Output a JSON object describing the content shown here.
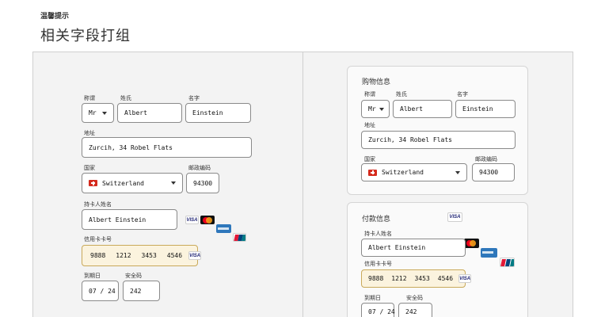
{
  "header": {
    "tip": "温馨提示",
    "title": "相关字段打组"
  },
  "left": {
    "labels": {
      "salutation": "称谓",
      "last_name": "姓氏",
      "first_name": "名字",
      "address": "地址",
      "country": "国家",
      "postcode": "邮政编码",
      "cardholder": "持卡人姓名",
      "card_number": "信用卡卡号",
      "expiry": "到期日",
      "cvc": "安全码"
    },
    "values": {
      "salutation": "Mr",
      "last_name": "Albert",
      "first_name": "Einstein",
      "address": "Zurcih, 34 Robel Flats",
      "country": "Switzerland",
      "postcode": "94300",
      "cardholder": "Albert Einstein",
      "card_groups": [
        "9888",
        "1212",
        "3453",
        "4546"
      ],
      "expiry": "07 / 24",
      "cvc": "242"
    }
  },
  "right": {
    "shipping": {
      "title": "购物信息",
      "labels": {
        "salutation": "称谓",
        "last_name": "姓氏",
        "first_name": "名字",
        "address": "地址",
        "country": "国家",
        "postcode": "邮政编码"
      },
      "values": {
        "salutation": "Mr",
        "last_name": "Albert",
        "first_name": "Einstein",
        "address": "Zurcih, 34 Robel Flats",
        "country": "Switzerland",
        "postcode": "94300"
      }
    },
    "payment": {
      "title": "付款信息",
      "labels": {
        "cardholder": "持卡人姓名",
        "card_number": "信用卡卡号",
        "expiry": "到期日",
        "cvc": "安全码"
      },
      "values": {
        "cardholder": "Albert Einstein",
        "card_groups": [
          "9888",
          "1212",
          "3453",
          "4546"
        ],
        "expiry": "07 / 24",
        "cvc": "242"
      }
    }
  },
  "card_brand": "VISA",
  "card_logos": [
    "visa-icon",
    "mastercard-icon",
    "amex-icon",
    "unionpay-icon"
  ],
  "colors": {
    "card_field_bg": "#fbf3de",
    "card_field_border": "#c9a95a",
    "swiss_red": "#d52b1e"
  }
}
